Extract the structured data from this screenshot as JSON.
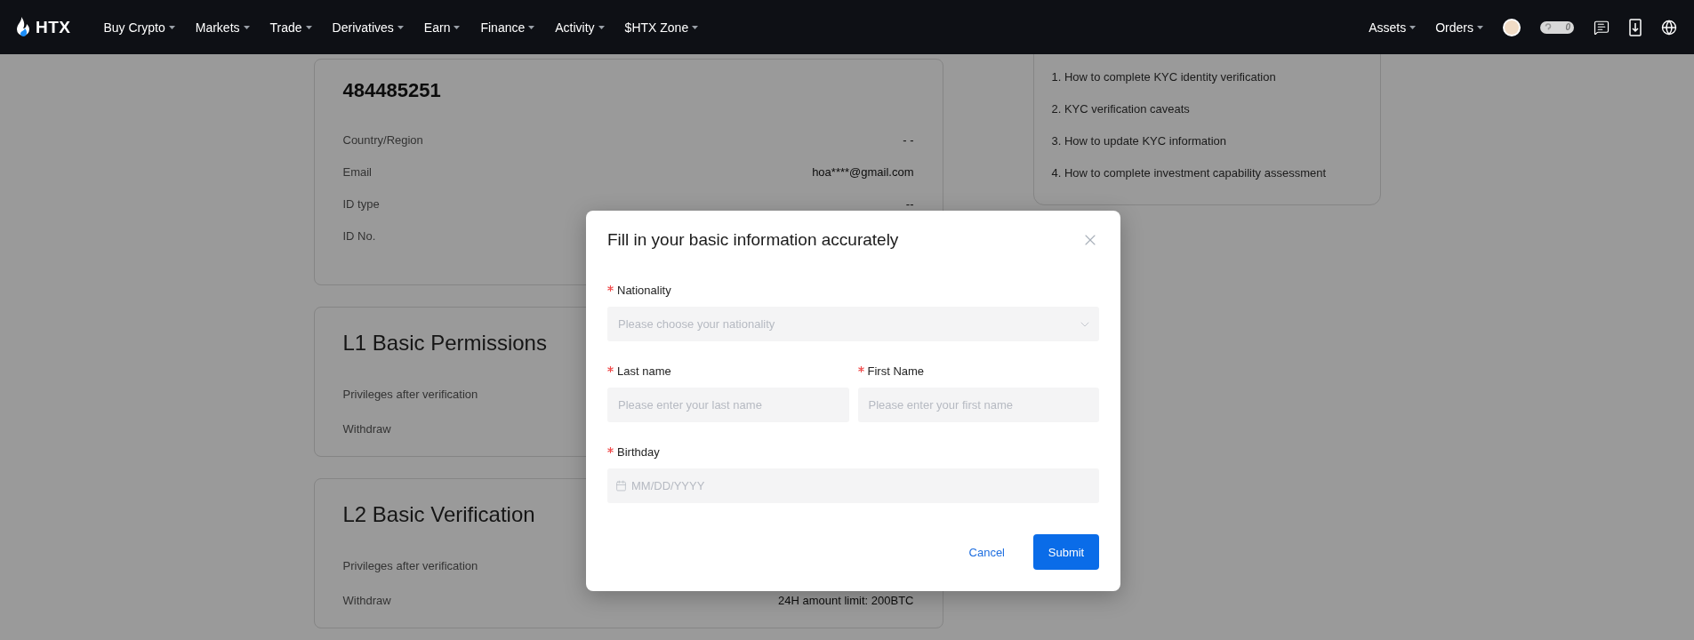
{
  "nav": {
    "logo": "HTX",
    "menu": [
      {
        "label": "Buy Crypto"
      },
      {
        "label": "Markets"
      },
      {
        "label": "Trade"
      },
      {
        "label": "Derivatives"
      },
      {
        "label": "Earn"
      },
      {
        "label": "Finance"
      },
      {
        "label": "Activity"
      },
      {
        "label": "$HTX Zone"
      }
    ],
    "right_menu": [
      {
        "label": "Assets"
      },
      {
        "label": "Orders"
      }
    ],
    "badge": "0"
  },
  "account": {
    "uid": "484485251",
    "rows": [
      {
        "label": "Country/Region",
        "value": "- -"
      },
      {
        "label": "Email",
        "value": "hoa****@gmail.com"
      },
      {
        "label": "ID type",
        "value": "--"
      },
      {
        "label": "ID No."
      }
    ]
  },
  "levels": [
    {
      "title": "L1 Basic Permissions",
      "rows": [
        {
          "label": "Privileges after verification"
        },
        {
          "label": "Withdraw"
        }
      ]
    },
    {
      "title": "L2 Basic Verification",
      "rows": [
        {
          "label": "Privileges after verification"
        },
        {
          "label": "Withdraw",
          "value": "24H amount limit: 200BTC"
        }
      ]
    }
  ],
  "help": {
    "links": [
      "1. How to complete KYC identity verification",
      "2. KYC verification caveats",
      "3. How to update KYC information",
      "4. How to complete investment capability assessment"
    ]
  },
  "modal": {
    "title": "Fill in your basic information accurately",
    "rows": [
      {
        "fields": [
          {
            "kind": "select",
            "label": "Nationality",
            "required": true,
            "placeholder": "Please choose your nationality"
          }
        ]
      },
      {
        "fields": [
          {
            "kind": "text",
            "label": "Last name",
            "required": true,
            "placeholder": "Please enter your last name"
          },
          {
            "kind": "text",
            "label": "First Name",
            "required": true,
            "placeholder": "Please enter your first name"
          }
        ]
      },
      {
        "fields": [
          {
            "kind": "date",
            "label": "Birthday",
            "required": true,
            "placeholder": "MM/DD/YYYY"
          }
        ]
      }
    ],
    "cancel": "Cancel",
    "submit": "Submit"
  }
}
